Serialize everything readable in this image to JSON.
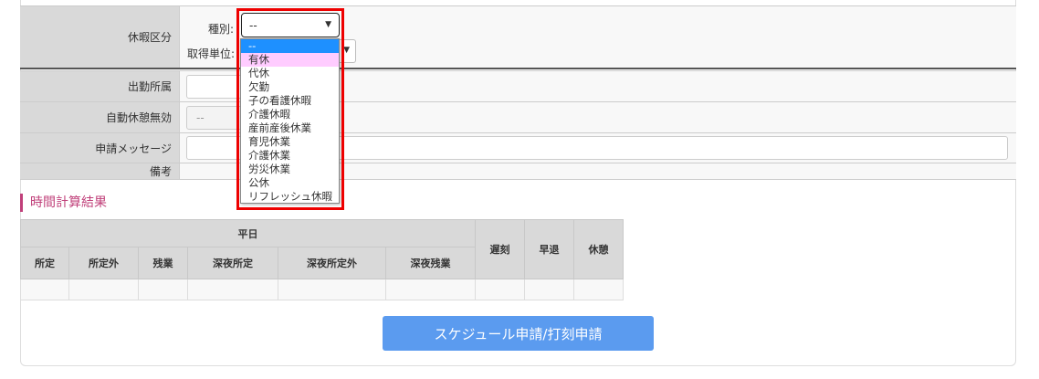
{
  "form": {
    "vacation_label": "休暇区分",
    "type_label": "種別:",
    "unit_label": "取得単位:",
    "type_value": "--",
    "attendance_label": "出勤所属",
    "auto_break_label": "自動休憩無効",
    "auto_break_value": "--",
    "message_label": "申請メッセージ",
    "notes_label": "備考"
  },
  "dropdown": {
    "options": [
      "--",
      "有休",
      "代休",
      "欠勤",
      "子の看護休暇",
      "介護休暇",
      "産前産後休業",
      "育児休業",
      "介護休業",
      "労災休業",
      "公休",
      "リフレッシュ休暇"
    ],
    "selected_color": "#1e90ff",
    "hover_color": "#ffccff"
  },
  "result": {
    "heading": "時間計算結果",
    "group_header": "平日",
    "columns": [
      "所定",
      "所定外",
      "残業",
      "深夜所定",
      "深夜所定外",
      "深夜残業"
    ],
    "side_columns": [
      "遅刻",
      "早退",
      "休憩"
    ]
  },
  "submit_label": "スケジュール申請/打刻申請"
}
